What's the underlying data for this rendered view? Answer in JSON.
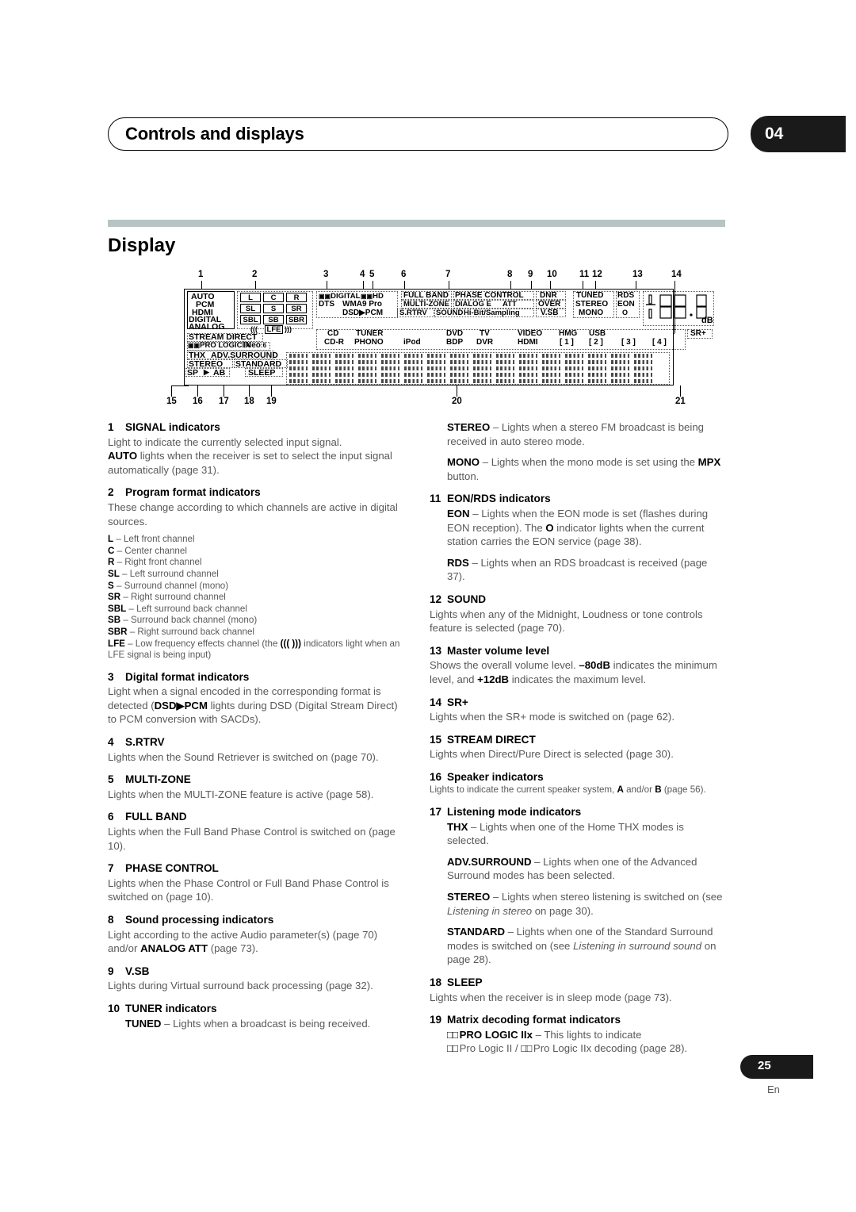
{
  "header": {
    "title": "Controls and displays",
    "chapter": "04"
  },
  "section": {
    "title": "Display"
  },
  "figure": {
    "callouts_top": [
      "1",
      "2",
      "3",
      "4",
      "5",
      "6",
      "7",
      "8",
      "9",
      "10",
      "11",
      "12",
      "13",
      "14"
    ],
    "callouts_bottom": [
      "15",
      "16",
      "17",
      "18",
      "19",
      "20",
      "21"
    ],
    "signal_indicators": [
      "AUTO",
      "PCM",
      "HDMI",
      "DIGITAL",
      "ANALOG"
    ],
    "channel_boxes": [
      "L",
      "C",
      "R",
      "SL",
      "S",
      "SR",
      "SBL",
      "SB",
      "SBR"
    ],
    "lfe_label": "LFE",
    "lfe_left_deco": "(((",
    "lfe_right_deco": ")))",
    "digital_format": {
      "row1": "DIGITAL",
      "row1b": "HD",
      "row2a": "DTS",
      "row2b": "WMA9 Pro",
      "row3": "DSD▶PCM"
    },
    "sound_block": {
      "full_band": "FULL BAND",
      "multi_zone": "MULTI-ZONE",
      "s_rtrv": "S.RTRV",
      "phase_control": "PHASE CONTROL",
      "dialog_e": "DIALOG E",
      "att": "ATT",
      "sound": "SOUND",
      "hi_bit": "Hi-Bit/Sampling",
      "dnr": "DNR",
      "over": "OVER",
      "vsb": "V.SB"
    },
    "tuner_block": {
      "tuned": "TUNED",
      "stereo": "STEREO",
      "mono": "MONO",
      "rds": "RDS",
      "eon": "EON",
      "eon_dot": "O"
    },
    "volume": {
      "digits": "88",
      "decimal": ".",
      "unit": "dB"
    },
    "sr_plus": "SR+",
    "input_row1": [
      "CD",
      "TUNER",
      "DVD",
      "TV",
      "VIDEO",
      "HMG",
      "USB"
    ],
    "input_row2": [
      "CD-R",
      "PHONO",
      "iPod",
      "BDP",
      "DVR",
      "HDMI",
      "[ 1 ]",
      "[ 2 ]",
      "[ 3 ]",
      "[ 4 ]"
    ],
    "mode_block": {
      "stream_direct": "STREAM DIRECT",
      "pro_logic": "PRO LOGIC",
      "pro_logic_ii": "Ⅱx",
      "neo": "Neo",
      "neo_6": ":6",
      "thx": "THX",
      "adv_surround": "ADV.SURROUND",
      "stereo": "STEREO",
      "standard": "STANDARD",
      "sp": "SP",
      "sp_arrow": "▶",
      "sp_ab": "AB",
      "sleep": "SLEEP"
    }
  },
  "left_column": {
    "item1": {
      "num": "1",
      "title": "SIGNAL indicators",
      "body_a": "Light to indicate the currently selected input signal.",
      "body_b_bold": "AUTO",
      "body_b": " lights when the receiver is set to select the input signal automatically (page 31)."
    },
    "item2": {
      "num": "2",
      "title": "Program format indicators",
      "body": "These change according to which channels are active in digital sources.",
      "channels": [
        {
          "code": "L",
          "desc": " – Left front channel"
        },
        {
          "code": "C",
          "desc": " – Center channel"
        },
        {
          "code": "R",
          "desc": " – Right front channel"
        },
        {
          "code": "SL",
          "desc": " – Left surround channel"
        },
        {
          "code": "S",
          "desc": " – Surround channel (mono)"
        },
        {
          "code": "SR",
          "desc": " – Right surround channel"
        },
        {
          "code": "SBL",
          "desc": " – Left surround back channel"
        },
        {
          "code": "SB",
          "desc": " – Surround back channel (mono)"
        },
        {
          "code": "SBR",
          "desc": " – Right surround back channel"
        }
      ],
      "lfe_code": "LFE",
      "lfe_desc_a": " – Low frequency effects channel (the ",
      "lfe_glyph": "(((   )))",
      "lfe_desc_b": " indicators light when an LFE signal is being input)"
    },
    "item3": {
      "num": "3",
      "title": "Digital format indicators",
      "body_a": "Light when a signal encoded in the corresponding format is detected (",
      "body_bold": "DSD▶PCM",
      "body_b": " lights during DSD (Digital Stream Direct) to PCM conversion with SACDs)."
    },
    "item4": {
      "num": "4",
      "title": "S.RTRV",
      "body": "Lights when the Sound Retriever is switched on (page 70)."
    },
    "item5": {
      "num": "5",
      "title": "MULTI-ZONE",
      "body": "Lights when the MULTI-ZONE feature is active (page 58)."
    },
    "item6": {
      "num": "6",
      "title": "FULL BAND",
      "body": "Lights when the Full Band Phase Control is switched on (page 10)."
    },
    "item7": {
      "num": "7",
      "title": "PHASE CONTROL",
      "body": "Lights when the Phase Control or Full Band Phase Control is switched on (page 10)."
    },
    "item8": {
      "num": "8",
      "title": "Sound processing indicators",
      "body_a": "Light according to the active Audio parameter(s) (page 70) and/or ",
      "body_bold": "ANALOG ATT",
      "body_b": " (page 73)."
    },
    "item9": {
      "num": "9",
      "title": "V.SB",
      "body": "Lights during Virtual surround back processing (page 32)."
    },
    "item10": {
      "num": "10",
      "title": "TUNER indicators",
      "tuned_bold": "TUNED",
      "tuned_desc": " – Lights when a broadcast is being received."
    }
  },
  "right_column": {
    "item10_cont": {
      "stereo_bold": "STEREO",
      "stereo_desc": " – Lights when a stereo FM broadcast is being received in auto stereo mode.",
      "mono_bold": "MONO",
      "mono_desc_a": " – Lights when the mono mode is set using the ",
      "mpx_bold": "MPX",
      "mono_desc_b": " button."
    },
    "item11": {
      "num": "11",
      "title": "EON/RDS indicators",
      "eon_bold": "EON",
      "eon_desc_a": " – Lights when the EON mode is set (flashes during EON reception). The ",
      "eon_glyph": "O",
      "eon_desc_b": " indicator lights when the current station carries the EON service (page 38).",
      "rds_bold": "RDS",
      "rds_desc": " – Lights when an RDS broadcast is received (page 37)."
    },
    "item12": {
      "num": "12",
      "title": "SOUND",
      "body": "Lights when any of the Midnight, Loudness or tone controls feature is selected (page 70)."
    },
    "item13": {
      "num": "13",
      "title": "Master volume level",
      "body_a": "Shows the overall volume level. ",
      "min_bold": "–80dB",
      "body_b": " indicates the minimum level, and ",
      "max_bold": "+12dB",
      "body_c": " indicates the maximum level."
    },
    "item14": {
      "num": "14",
      "title": "SR+",
      "body": "Lights when the SR+ mode is switched on (page 62)."
    },
    "item15": {
      "num": "15",
      "title": "STREAM DIRECT",
      "body": "Lights when Direct/Pure Direct is selected (page 30)."
    },
    "item16": {
      "num": "16",
      "title": "Speaker indicators",
      "body_a": "Lights to indicate the current speaker system, ",
      "a_bold": "A",
      "body_b": " and/or ",
      "b_bold": "B",
      "body_c": " (page 56)."
    },
    "item17": {
      "num": "17",
      "title": "Listening mode indicators",
      "thx_bold": "THX",
      "thx_desc": " – Lights when one of the Home THX modes is selected.",
      "adv_bold": "ADV.SURROUND",
      "adv_desc": " – Lights when one of the Advanced Surround modes has been selected.",
      "stereo_bold": "STEREO",
      "stereo_desc_a": " – Lights when stereo listening is switched on (see ",
      "stereo_italic": "Listening in stereo",
      "stereo_desc_b": " on page 30).",
      "standard_bold": "STANDARD",
      "standard_desc_a": " – Lights when one of the Standard Surround modes is switched on (see ",
      "standard_italic": "Listening in surround sound",
      "standard_desc_b": " on page 28)."
    },
    "item18": {
      "num": "18",
      "title": "SLEEP",
      "body": "Lights when the receiver is in sleep mode (page 73)."
    },
    "item19": {
      "num": "19",
      "title": "Matrix decoding format indicators",
      "pl_glyph": "□□",
      "pl_bold": " PRO LOGIC IIx",
      "pl_desc": " – This lights to indicate",
      "pl2_glyph": "□□",
      "pl2_desc_a": " Pro Logic II / ",
      "pl2_glyph2": "□□",
      "pl2_desc_b": " Pro Logic IIx decoding (page 28)."
    }
  },
  "footer": {
    "page": "25",
    "language": "En"
  }
}
